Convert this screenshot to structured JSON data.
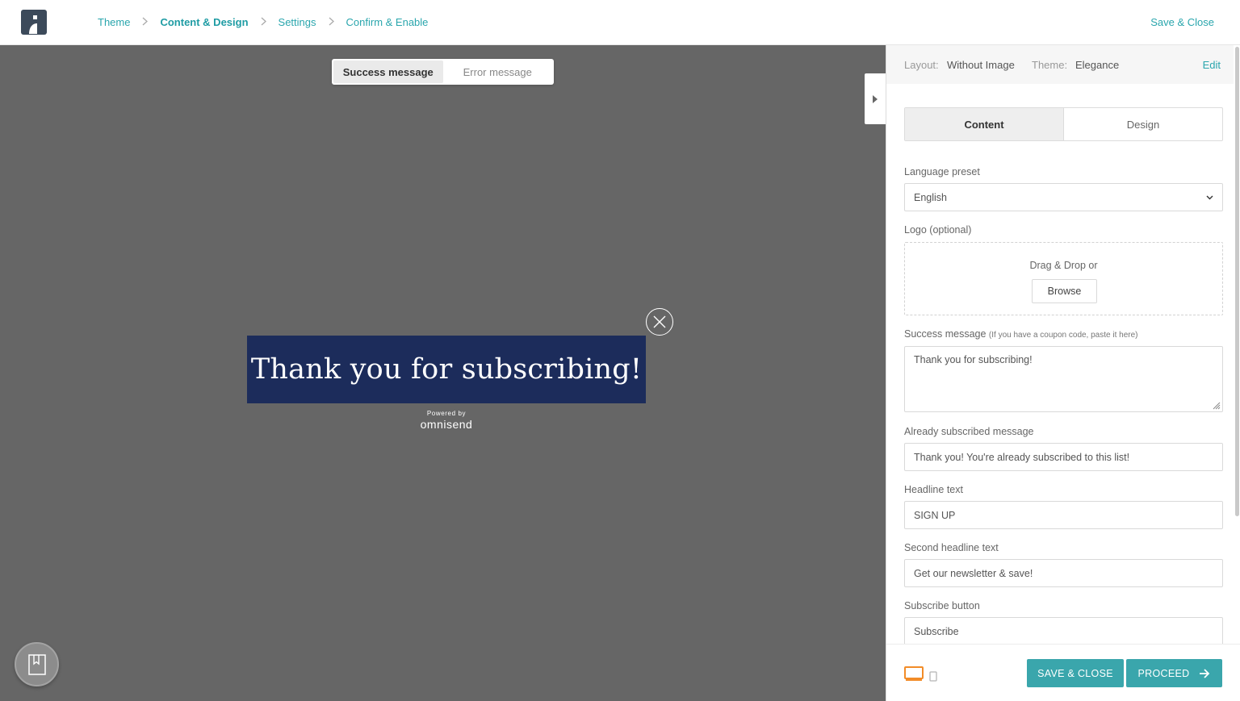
{
  "breadcrumbs": {
    "step1": "Theme",
    "step2": "Content & Design",
    "step3": "Settings",
    "step4": "Confirm & Enable",
    "separator": ">"
  },
  "header": {
    "save_close": "Save & Close"
  },
  "preview": {
    "toggle": {
      "success": "Success message",
      "error": "Error message",
      "active": "success"
    },
    "popup_text": "Thank you for subscribing!",
    "powered_by": "Powered by",
    "brand": "omnisend",
    "popup_color": "#1c2c5b",
    "canvas_color": "#666666"
  },
  "panel": {
    "layout_label": "Layout:",
    "layout_value": "Without Image",
    "theme_label": "Theme:",
    "theme_value": "Elegance",
    "edit": "Edit",
    "tabs": {
      "content": "Content",
      "design": "Design",
      "active": "content"
    },
    "language_label": "Language preset",
    "language_value": "English",
    "logo_label": "Logo (optional)",
    "drag_drop": "Drag & Drop or",
    "browse": "Browse",
    "success_label": "Success message",
    "success_hint": "(If you have a coupon code, paste it here)",
    "success_value": "Thank you for subscribing!",
    "already_label": "Already subscribed message",
    "already_value": "Thank you! You're already subscribed to this list!",
    "headline_label": "Headline text",
    "headline_value": "SIGN UP",
    "second_headline_label": "Second headline text",
    "second_headline_value": "Get our newsletter & save!",
    "subscribe_label": "Subscribe button",
    "subscribe_value": "Subscribe"
  },
  "footer": {
    "save_close": "SAVE & CLOSE",
    "proceed": "PROCEED",
    "accent": "#3aa6ac",
    "device_active_color": "#f28c28"
  },
  "icons": {
    "logo": "omnisend-logo-icon",
    "close": "close-circle-icon",
    "panel_toggle": "caret-right-icon",
    "bookmark": "bookmark-icon",
    "select": "chevron-down-icon",
    "desktop": "desktop-icon",
    "mobile": "mobile-icon",
    "proceed": "arrow-right-icon"
  }
}
